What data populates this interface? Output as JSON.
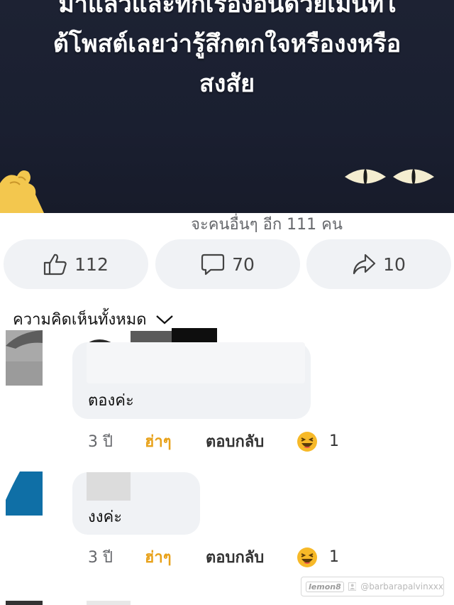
{
  "post": {
    "caption_lines": [
      "มาแล้วและทักเรื่องอื่นด้วยเมนท์ใ",
      "ต้โพสต์เลยว่ารู้สึกตกใจหรืองงหรือ",
      "สงสัย"
    ]
  },
  "reactions": {
    "summary": "จะคนอื่นๆ อีก 111 คน"
  },
  "actions": {
    "like_count": "112",
    "comment_count": "70",
    "share_count": "10"
  },
  "comments_section": {
    "header": "ความคิดเห็นทั้งหมด"
  },
  "comments": [
    {
      "text": "ตองค่ะ",
      "time": "3 ปี",
      "haha_label": "ฮ่าๆ",
      "reply_label": "ตอบกลับ",
      "reaction_count": "1"
    },
    {
      "text": "งงค่ะ",
      "time": "3 ปี",
      "haha_label": "ฮ่าๆ",
      "reply_label": "ตอบกลับ",
      "reaction_count": "1"
    }
  ],
  "watermark": {
    "brand": "lemon8",
    "handle": "@barbarapalvinxxx"
  },
  "colors": {
    "haha_accent": "#e8a21b",
    "bubble_bg": "#f0f2f5",
    "button_bg": "#f0f2f5"
  }
}
